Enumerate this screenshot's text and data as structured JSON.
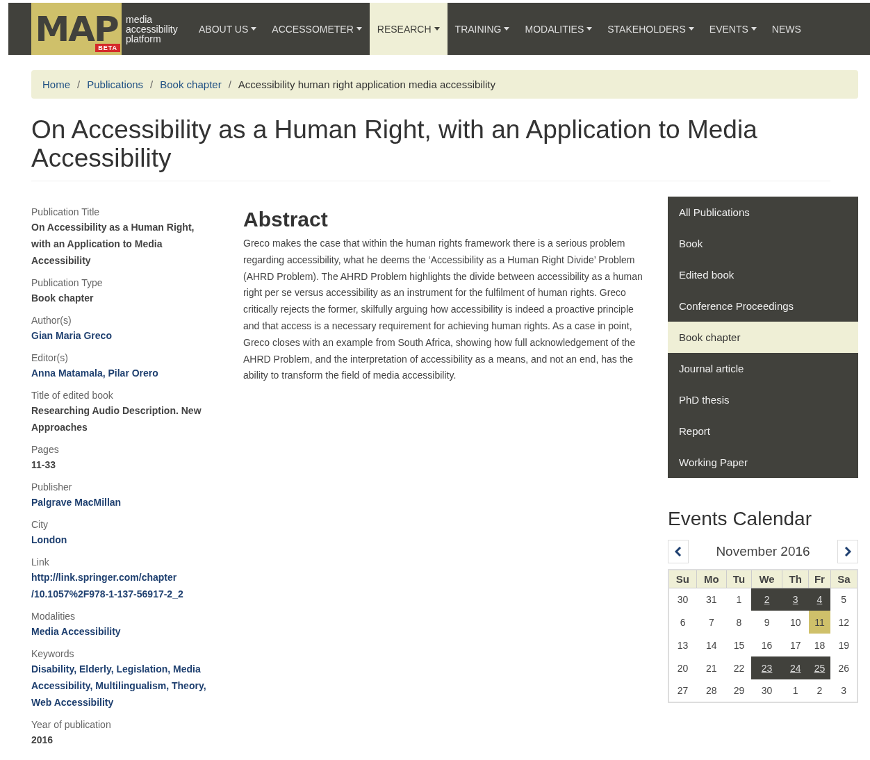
{
  "logo": {
    "letters": "MAP",
    "badge": "BETA",
    "tagline": [
      "media",
      "accessibility",
      "platform"
    ]
  },
  "nav": [
    {
      "label": "ABOUT US",
      "dropdown": true,
      "selected": false
    },
    {
      "label": "ACCESSOMETER",
      "dropdown": true,
      "selected": false
    },
    {
      "label": "RESEARCH",
      "dropdown": true,
      "selected": true
    },
    {
      "label": "TRAINING",
      "dropdown": true,
      "selected": false
    },
    {
      "label": "MODALITIES",
      "dropdown": true,
      "selected": false
    },
    {
      "label": "STAKEHOLDERS",
      "dropdown": true,
      "selected": false
    },
    {
      "label": "EVENTS",
      "dropdown": true,
      "selected": false
    },
    {
      "label": "NEWS",
      "dropdown": false,
      "selected": false
    }
  ],
  "breadcrumb": [
    {
      "label": "Home",
      "kind": "link"
    },
    {
      "separator": "/",
      "label": "Publications",
      "kind": "link"
    },
    {
      "separator": "/",
      "label": "Book chapter",
      "kind": "link"
    },
    {
      "separator": "/",
      "label": "Accessibility human right application media accessibility",
      "kind": "current"
    }
  ],
  "page_title": "On Accessibility as a Human Right, with an Application to Media Accessibility",
  "details": [
    {
      "label": "Publication Title",
      "value": "On Accessibility as a Human Right, with an Application to Media Accessibility",
      "kind": "text"
    },
    {
      "label": "Publication Type",
      "value": "Book chapter",
      "kind": "text"
    },
    {
      "label": "Author(s)",
      "value": "Gian Maria Greco",
      "kind": "link"
    },
    {
      "label": "Editor(s)",
      "value": "Anna Matamala, Pilar Orero",
      "kind": "link"
    },
    {
      "label": "Title of edited book",
      "value": "Researching Audio Description. New Approaches",
      "kind": "text"
    },
    {
      "label": "Pages",
      "value": "11-33",
      "kind": "text"
    },
    {
      "label": "Publisher",
      "value": "Palgrave MacMillan",
      "kind": "link"
    },
    {
      "label": "City",
      "value": "London",
      "kind": "link"
    },
    {
      "label": "Link",
      "value": "http://link.springer.com/chapter /10.1057%2F978-1-137-56917-2_2",
      "kind": "link"
    },
    {
      "label": "Modalities",
      "value": "Media Accessibility",
      "kind": "link"
    },
    {
      "label": "Keywords",
      "value": "Disability, Elderly, Legislation, Media Accessibility, Multilingualism, Theory, Web Accessibility",
      "kind": "link"
    },
    {
      "label": "Year of publication",
      "value": "2016",
      "kind": "text"
    }
  ],
  "abstract": {
    "heading": "Abstract",
    "text": "Greco makes the case that within the human rights framework there is a serious problem regarding accessibility, what he deems the ‘Accessibility as a Human Right Divide’ Problem (AHRD Problem). The AHRD Problem highlights the divide between accessibility as a human right per se versus accessibility as an instrument for the fulfilment of human rights. Greco critically rejects the former, skilfully arguing how accessibility is indeed a proactive principle and that access is a necessary requirement for achieving human rights. As a case in point, Greco closes with an example from South Africa, showing how full acknowledgement of the AHRD Problem, and the interpretation of accessibility as a means, and not an end, has the ability to transform the field of media accessibility."
  },
  "side_menu": [
    {
      "label": "All Publications",
      "selected": false
    },
    {
      "label": "Book",
      "selected": false
    },
    {
      "label": "Edited book",
      "selected": false
    },
    {
      "label": "Conference Proceedings",
      "selected": false
    },
    {
      "label": "Book chapter",
      "selected": true
    },
    {
      "label": "Journal article",
      "selected": false
    },
    {
      "label": "PhD thesis",
      "selected": false
    },
    {
      "label": "Report",
      "selected": false
    },
    {
      "label": "Working Paper",
      "selected": false
    }
  ],
  "calendar": {
    "title": "Events Calendar",
    "month": "November 2016",
    "weekdays": [
      "Su",
      "Mo",
      "Tu",
      "We",
      "Th",
      "Fr",
      "Sa"
    ],
    "weeks": [
      [
        {
          "day": "30",
          "kind": "plain"
        },
        {
          "day": "31",
          "kind": "plain"
        },
        {
          "day": "1",
          "kind": "plain"
        },
        {
          "day": "2",
          "kind": "event"
        },
        {
          "day": "3",
          "kind": "event"
        },
        {
          "day": "4",
          "kind": "event"
        },
        {
          "day": "5",
          "kind": "plain"
        }
      ],
      [
        {
          "day": "6",
          "kind": "plain"
        },
        {
          "day": "7",
          "kind": "plain"
        },
        {
          "day": "8",
          "kind": "plain"
        },
        {
          "day": "9",
          "kind": "plain"
        },
        {
          "day": "10",
          "kind": "plain"
        },
        {
          "day": "11",
          "kind": "today"
        },
        {
          "day": "12",
          "kind": "plain"
        }
      ],
      [
        {
          "day": "13",
          "kind": "plain"
        },
        {
          "day": "14",
          "kind": "plain"
        },
        {
          "day": "15",
          "kind": "plain"
        },
        {
          "day": "16",
          "kind": "plain"
        },
        {
          "day": "17",
          "kind": "plain"
        },
        {
          "day": "18",
          "kind": "plain"
        },
        {
          "day": "19",
          "kind": "plain"
        }
      ],
      [
        {
          "day": "20",
          "kind": "plain"
        },
        {
          "day": "21",
          "kind": "plain"
        },
        {
          "day": "22",
          "kind": "plain"
        },
        {
          "day": "23",
          "kind": "event"
        },
        {
          "day": "24",
          "kind": "event"
        },
        {
          "day": "25",
          "kind": "event"
        },
        {
          "day": "26",
          "kind": "plain"
        }
      ],
      [
        {
          "day": "27",
          "kind": "plain"
        },
        {
          "day": "28",
          "kind": "plain"
        },
        {
          "day": "29",
          "kind": "plain"
        },
        {
          "day": "30",
          "kind": "plain"
        },
        {
          "day": "1",
          "kind": "plain"
        },
        {
          "day": "2",
          "kind": "plain"
        },
        {
          "day": "3",
          "kind": "plain"
        }
      ]
    ]
  }
}
